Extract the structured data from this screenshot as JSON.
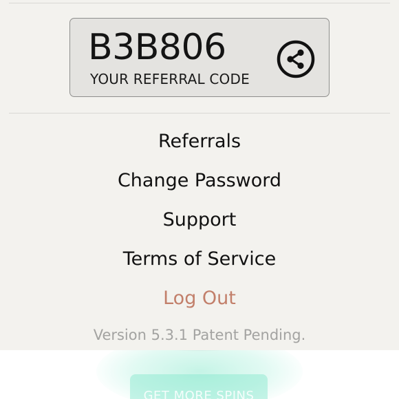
{
  "referral": {
    "code": "B3B806",
    "caption": "YOUR REFERRAL CODE",
    "share_icon": "share-icon"
  },
  "menu": {
    "items": [
      {
        "label": "Referrals"
      },
      {
        "label": "Change Password"
      },
      {
        "label": "Support"
      },
      {
        "label": "Terms of Service"
      },
      {
        "label": "Log Out"
      }
    ]
  },
  "footer": {
    "version": "Version 5.3.1 Patent Pending."
  },
  "background": {
    "button_label": "GET MORE SPINS"
  },
  "colors": {
    "panel_background": "#f3f2ee",
    "card_background": "#e4e3e0",
    "logout_text": "#c27f6a",
    "version_text": "#a3a3a1",
    "accent_green": "#82e6cd"
  }
}
